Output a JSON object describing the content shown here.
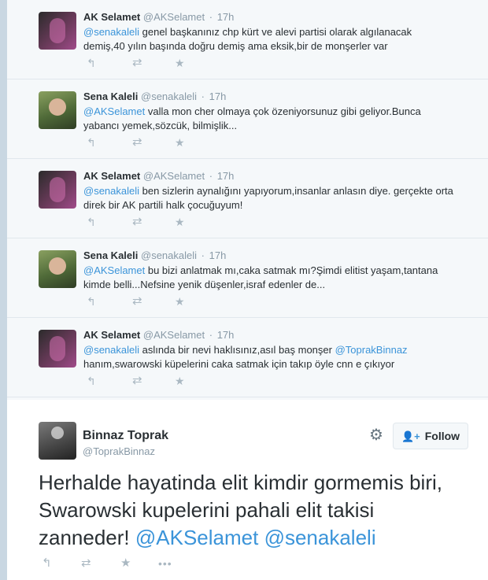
{
  "tweets": [
    {
      "name": "AK Selamet",
      "handle": "@AKSelamet",
      "time": "17h",
      "mention": "@senakaleli",
      "text": " genel başkanınız chp kürt ve alevi partisi olarak algılanacak demiş,40 yılın başında doğru demiş ama eksik,bir de monşerler var"
    },
    {
      "name": "Sena Kaleli",
      "handle": "@senakaleli",
      "time": "17h",
      "mention": "@AKSelamet",
      "text": " valla mon cher olmaya çok özeniyorsunuz gibi geliyor.Bunca yabancı yemek,sözcük, bilmişlik..."
    },
    {
      "name": "AK Selamet",
      "handle": "@AKSelamet",
      "time": "17h",
      "mention": "@senakaleli",
      "text": " ben sizlerin aynalığını yapıyorum,insanlar anlasın diye. gerçekte orta direk bir AK partili halk çocuğuyum!"
    },
    {
      "name": "Sena Kaleli",
      "handle": "@senakaleli",
      "time": "17h",
      "mention": "@AKSelamet",
      "text": " bu bizi anlatmak mı,caka satmak mı?Şimdi elitist yaşam,tantana kimde belli...Nefsine yenik düşenler,israf edenler de..."
    },
    {
      "name": "AK Selamet",
      "handle": "@AKSelamet",
      "time": "17h",
      "mention": "@senakaleli",
      "text_a": " aslında bir nevi haklısınız,asıl baş monşer ",
      "mention2": "@ToprakBinnaz",
      "text_b": " hanım,swarowski küpelerini caka satmak için takıp öyle cnn e çıkıyor"
    }
  ],
  "main": {
    "name": "Binnaz Toprak",
    "handle": "@ToprakBinnaz",
    "follow_label": "Follow",
    "text": "Herhalde hayatinda elit kimdir gormemis biri, Swarowski kupelerini pahali elit takisi zanneder! ",
    "mention1": "@AKSelamet",
    "mention2": "@senakaleli"
  },
  "icons": {
    "reply": "reply-icon",
    "retweet": "retweet-icon",
    "favorite": "favorite-icon",
    "more": "more-icon",
    "gear": "gear-icon",
    "follow": "follow-person-icon"
  },
  "colors": {
    "link": "#3b94d9",
    "text": "#292f33",
    "muted": "#8899a6",
    "action": "#aab8c2"
  }
}
